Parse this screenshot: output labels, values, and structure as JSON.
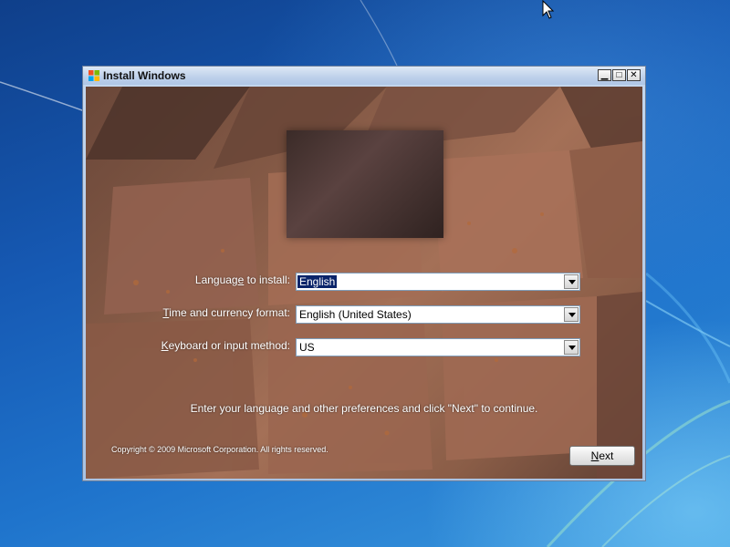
{
  "window": {
    "title": "Install Windows",
    "icon": "windows-flag-icon",
    "controls": [
      "minimize-icon",
      "maximize-icon",
      "close-icon"
    ]
  },
  "form": {
    "language": {
      "label_pre": "Languag",
      "label_key": "e",
      "label_post": " to install:",
      "value": "English"
    },
    "time_currency": {
      "label_key": "T",
      "label_post": "ime and currency format:",
      "value": "English (United States)"
    },
    "keyboard": {
      "label_key": "K",
      "label_post": "eyboard or input method:",
      "value": "US"
    }
  },
  "instruction": "Enter your language and other preferences and click \"Next\" to continue.",
  "copyright": "Copyright © 2009 Microsoft Corporation. All rights reserved.",
  "next_button": {
    "label_key": "N",
    "label_post": "ext"
  },
  "colors": {
    "desktop_blue": "#1e63b8",
    "selection": "#0a246a"
  }
}
